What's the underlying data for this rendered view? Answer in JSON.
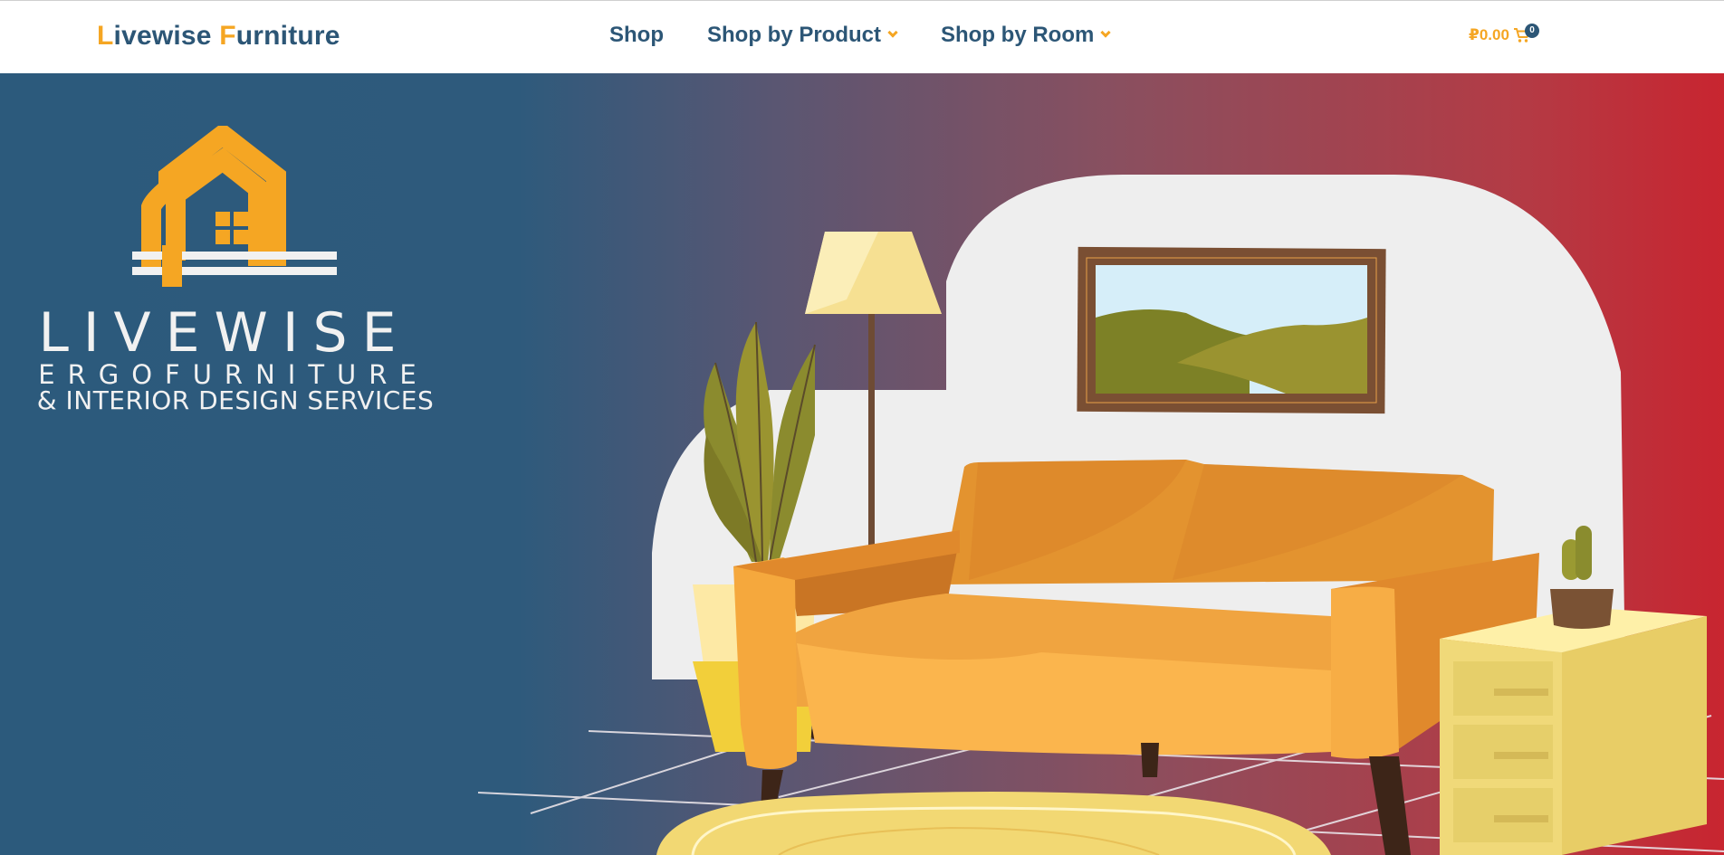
{
  "header": {
    "brand_first_letter": "L",
    "brand_word_1_rest": "ivewise ",
    "brand_second_letter": "F",
    "brand_word_2_rest": "urniture",
    "nav": [
      {
        "label": "Shop",
        "has_dropdown": false
      },
      {
        "label": "Shop by Product",
        "has_dropdown": true
      },
      {
        "label": "Shop by Room",
        "has_dropdown": true
      }
    ],
    "cart_amount": "₽0.00",
    "cart_count": "0"
  },
  "hero": {
    "logo_line_1": "LIVEWISE",
    "logo_line_2": "ERGOFURNITURE",
    "logo_line_3": "& INTERIOR DESIGN SERVICES"
  },
  "colors": {
    "brand_blue": "#2c5676",
    "accent_orange": "#f5a623",
    "hero_left": "#2c5a7c",
    "hero_right": "#c82530"
  }
}
